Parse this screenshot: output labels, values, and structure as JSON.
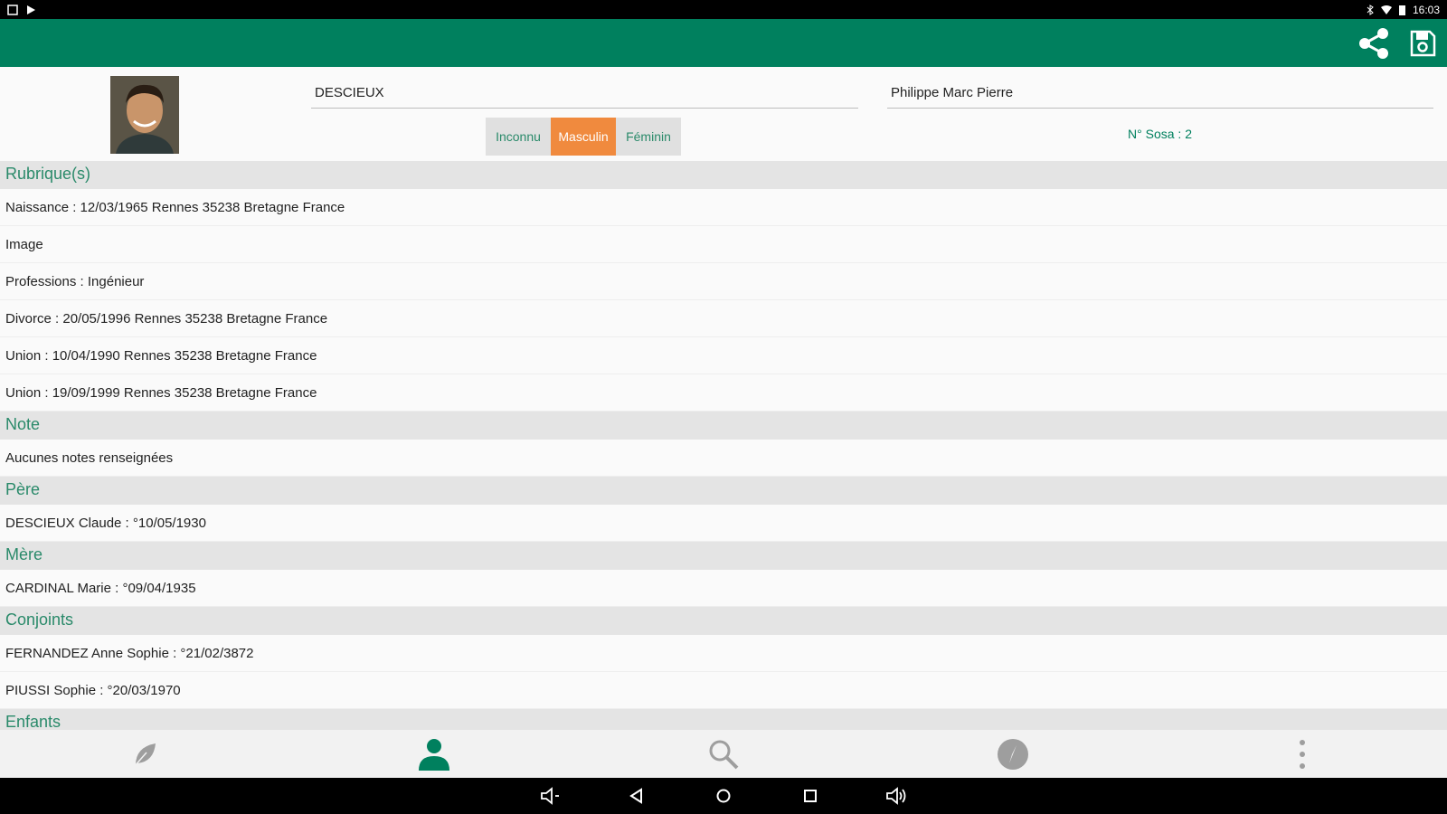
{
  "status_bar": {
    "time": "16:03"
  },
  "header": {
    "surname": "DESCIEUX",
    "given_names": "Philippe Marc Pierre",
    "gender_options": [
      "Inconnu",
      "Masculin",
      "Féminin"
    ],
    "selected_gender": "Masculin",
    "sosa": "N° Sosa : 2"
  },
  "sections": [
    {
      "title": "Rubrique(s)",
      "rows": [
        "Naissance : 12/03/1965 Rennes 35238 Bretagne France",
        "Image",
        "Professions : Ingénieur",
        "Divorce : 20/05/1996 Rennes 35238 Bretagne France",
        "Union : 10/04/1990 Rennes 35238 Bretagne France",
        "Union : 19/09/1999 Rennes 35238 Bretagne France"
      ]
    },
    {
      "title": "Note",
      "rows": [
        "Aucunes notes renseignées"
      ]
    },
    {
      "title": "Père",
      "rows": [
        "DESCIEUX Claude : °10/05/1930"
      ]
    },
    {
      "title": "Mère",
      "rows": [
        "CARDINAL Marie : °09/04/1935"
      ]
    },
    {
      "title": "Conjoints",
      "rows": [
        "FERNANDEZ Anne Sophie : °21/02/3872",
        "PIUSSI Sophie : °20/03/1970"
      ]
    },
    {
      "title": "Enfants",
      "rows": []
    }
  ],
  "bottom_nav": [
    {
      "icon": "leaf-icon",
      "active": false
    },
    {
      "icon": "person-icon",
      "active": true
    },
    {
      "icon": "search-icon",
      "active": false
    },
    {
      "icon": "compass-icon",
      "active": false
    },
    {
      "icon": "more-vert-icon",
      "active": false
    }
  ],
  "colors": {
    "primary": "#00805e",
    "accent": "#f08a3e",
    "section_bg": "#e4e4e4"
  }
}
